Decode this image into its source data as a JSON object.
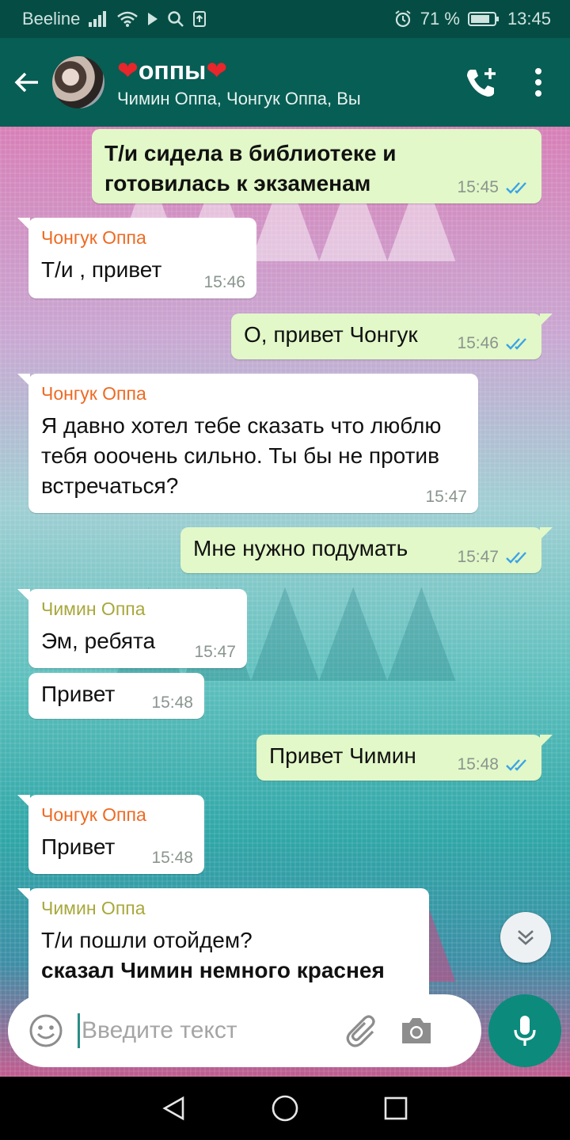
{
  "status_bar": {
    "carrier": "Beeline",
    "battery": "71 %",
    "time": "13:45"
  },
  "header": {
    "title": "оппы",
    "title_emoji": "❤",
    "subtitle": "Чимин Оппа, Чонгук Оппа, Вы"
  },
  "messages": [
    {
      "dir": "out",
      "text": "Т/и сидела в библиотеке и готовилась к экзаменам",
      "time": "15:45",
      "bold": true
    },
    {
      "dir": "in",
      "sender": "Чонгук Оппа",
      "text": "Т/и , привет",
      "time": "15:46"
    },
    {
      "dir": "out",
      "text": "О, привет Чонгук",
      "time": "15:46"
    },
    {
      "dir": "in",
      "sender": "Чонгук Оппа",
      "text": "Я давно хотел тебе сказать что люблю тебя ооочень сильно. Ты бы не против встречаться?",
      "time": "15:47"
    },
    {
      "dir": "out",
      "text": "Мне нужно подумать",
      "time": "15:47"
    },
    {
      "dir": "in",
      "sender": "Чимин Оппа",
      "text": "Эм, ребята",
      "time": "15:47"
    },
    {
      "dir": "in",
      "text": "Привет",
      "time": "15:48"
    },
    {
      "dir": "out",
      "text": "Привет Чимин",
      "time": "15:48"
    },
    {
      "dir": "in",
      "sender": "Чонгук Оппа",
      "text": "Привет",
      "time": "15:48"
    },
    {
      "dir": "in",
      "sender": "Чимин Оппа",
      "text": "Т/и пошли отойдем?",
      "text_bold": "сказал Чимин немного краснея"
    }
  ],
  "input": {
    "placeholder": "Введите текст"
  },
  "colors": {
    "header": "#075e54",
    "outgoing_bubble": "#e2f8c8",
    "incoming_bubble": "#ffffff",
    "jungkook_name": "#ee6a22",
    "jimin_name": "#a8a83d",
    "read_ticks": "#3ba3e6",
    "mic_button": "#0c8b7c"
  },
  "icons": [
    "back-arrow-icon",
    "add-call-icon",
    "more-vert-icon",
    "emoji-icon",
    "attach-icon",
    "camera-icon",
    "mic-icon",
    "chevron-double-down-icon"
  ]
}
